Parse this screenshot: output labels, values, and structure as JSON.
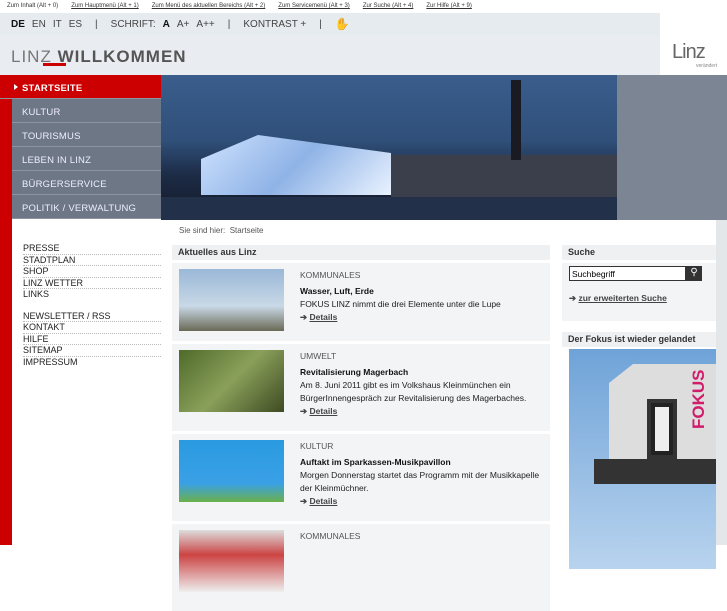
{
  "skip_links": [
    "Zum Inhalt (Alt + 0)",
    "Zum Hauptmenü (Alt + 1)",
    "Zum Menü des aktuellen Bereichs (Alt + 2)",
    "Zum Servicemenü (Alt + 3)",
    "Zur Suche (Alt + 4)",
    "Zur Hilfe (Alt + 9)"
  ],
  "languages": [
    "DE",
    "EN",
    "IT",
    "ES"
  ],
  "font_label": "SCHRIFT:",
  "font_sizes": [
    "A",
    "A+",
    "A++"
  ],
  "contrast": "KONTRAST +",
  "separator": "|",
  "brand": {
    "prefix": "LINZ",
    "title": "WILLKOMMEN"
  },
  "logo": {
    "text": "Linz",
    "sub": "verändert"
  },
  "nav": [
    "STARTSEITE",
    "KULTUR",
    "TOURISMUS",
    "LEBEN IN LINZ",
    "BÜRGERSERVICE",
    "POLITIK / VERWALTUNG"
  ],
  "service1": [
    "PRESSE",
    "STADTPLAN",
    "SHOP",
    "LINZ WETTER",
    "LINKS"
  ],
  "service2": [
    "NEWSLETTER / RSS",
    "KONTAKT",
    "HILFE",
    "SITEMAP",
    "IMPRESSUM"
  ],
  "breadcrumb": {
    "label": "Sie sind hier:",
    "current": "Startseite"
  },
  "news": {
    "heading": "Aktuelles aus Linz",
    "details": "Details",
    "items": [
      {
        "cat": "KOMMUNALES",
        "title": "Wasser, Luft, Erde",
        "text": "FOKUS LINZ nimmt die drei Elemente unter die Lupe"
      },
      {
        "cat": "UMWELT",
        "title": "Revitalisierung Magerbach",
        "text": "Am 8. Juni 2011 gibt es im Volkshaus Kleinmünchen ein BürgerInnengespräch zur Revitalisierung des Magerbaches."
      },
      {
        "cat": "KULTUR",
        "title": "Auftakt im Sparkassen-Musikpavillon",
        "text": "Morgen Donnerstag startet das Programm mit der Musikkapelle der Kleinmüchner."
      },
      {
        "cat": "KOMMUNALES",
        "title": "",
        "text": ""
      }
    ]
  },
  "search": {
    "heading": "Suche",
    "value": "Suchbegriff",
    "advanced": "zur erweiterten Suche"
  },
  "fokus": {
    "heading": "Der Fokus ist wieder gelandet",
    "image_text": "FOKUS"
  }
}
